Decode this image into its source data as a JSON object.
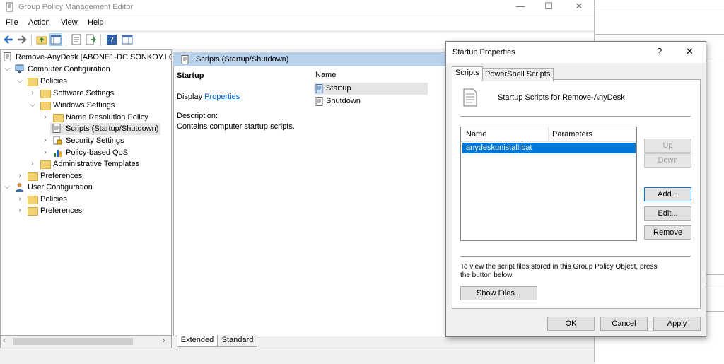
{
  "window": {
    "title": "Group Policy Management Editor",
    "controls": {
      "minimize": "—",
      "maximize": "☐",
      "close": "✕"
    }
  },
  "menu": [
    "File",
    "Action",
    "View",
    "Help"
  ],
  "tree": {
    "root": "Remove-AnyDesk [ABONE1-DC.SONKOY.LO",
    "computer_configuration": "Computer Configuration",
    "policies": "Policies",
    "software_settings": "Software Settings",
    "windows_settings": "Windows Settings",
    "name_resolution_policy": "Name Resolution Policy",
    "scripts": "Scripts (Startup/Shutdown)",
    "security_settings": "Security Settings",
    "policy_qos": "Policy-based QoS",
    "administrative_templates": "Administrative Templates",
    "preferences": "Preferences",
    "user_configuration": "User Configuration",
    "user_policies": "Policies",
    "user_preferences": "Preferences"
  },
  "details": {
    "header": "Scripts (Startup/Shutdown)",
    "heading": "Startup",
    "display_prefix": "Display ",
    "display_link": "Properties",
    "description_label": "Description:",
    "description_text": "Contains computer startup scripts.",
    "column_name": "Name",
    "items": [
      "Startup",
      "Shutdown"
    ]
  },
  "bottom_tabs": [
    "Extended",
    "Standard"
  ],
  "dialog": {
    "title": "Startup Properties",
    "help": "?",
    "close": "✕",
    "tabs": [
      "Scripts",
      "PowerShell Scripts"
    ],
    "heading": "Startup Scripts for Remove-AnyDesk",
    "columns": [
      "Name",
      "Parameters"
    ],
    "rows": [
      {
        "name": "anydeskunistall.bat",
        "parameters": ""
      }
    ],
    "buttons": {
      "up": "Up",
      "down": "Down",
      "add": "Add...",
      "edit": "Edit...",
      "remove": "Remove",
      "show_files": "Show Files...",
      "ok": "OK",
      "cancel": "Cancel",
      "apply": "Apply"
    },
    "info_text_1": "To view the script files stored in this Group Policy Object, press",
    "info_text_2": "the button below."
  },
  "colors": {
    "selection": "#0078d7",
    "tree_highlight": "#cce8ff",
    "header_bar": "#b9d1ea",
    "link": "#0066cc"
  }
}
